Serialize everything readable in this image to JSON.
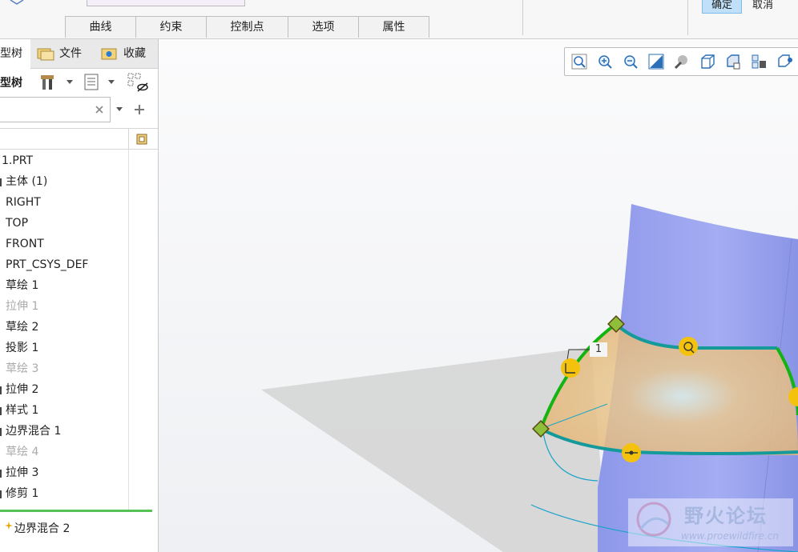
{
  "ribbon": {
    "tabs": [
      "曲线",
      "约束",
      "控制点",
      "选项",
      "属性"
    ],
    "ok_label": "确定",
    "cancel_label": "取消"
  },
  "panel": {
    "tabs": [
      {
        "label": "型树",
        "icon": "model-tree-icon"
      },
      {
        "label": "文件",
        "icon": "folder-icon"
      },
      {
        "label": "收藏",
        "icon": "favorites-icon"
      }
    ],
    "tree_title": "型树",
    "search": {
      "value": "",
      "clear_icon": "close-icon"
    },
    "tree_items": [
      {
        "label": "1.PRT",
        "state": "normal"
      },
      {
        "label": "主体 (1)",
        "state": "normal"
      },
      {
        "label": "RIGHT",
        "state": "normal"
      },
      {
        "label": "TOP",
        "state": "normal"
      },
      {
        "label": "FRONT",
        "state": "normal"
      },
      {
        "label": "PRT_CSYS_DEF",
        "state": "normal"
      },
      {
        "label": "草绘 1",
        "state": "normal"
      },
      {
        "label": "拉伸 1",
        "state": "suppressed"
      },
      {
        "label": "草绘 2",
        "state": "normal"
      },
      {
        "label": "投影 1",
        "state": "normal"
      },
      {
        "label": "草绘 3",
        "state": "suppressed"
      },
      {
        "label": "拉伸 2",
        "state": "normal"
      },
      {
        "label": "样式 1",
        "state": "normal"
      },
      {
        "label": "边界混合 1",
        "state": "normal"
      },
      {
        "label": "草绘 4",
        "state": "suppressed"
      },
      {
        "label": "拉伸 3",
        "state": "normal"
      },
      {
        "label": "修剪 1",
        "state": "normal"
      }
    ],
    "active_feature": "边界混合 2"
  },
  "view_toolbar": {
    "icons": [
      "zoom-fit-icon",
      "zoom-in-icon",
      "zoom-out-icon",
      "repaint-icon",
      "appearance-icon",
      "display-style-icon",
      "saved-views-icon",
      "view-manager-icon",
      "annotation-display-icon"
    ]
  },
  "viewport": {
    "dimension_label": "1",
    "watermark_title": "野火论坛",
    "watermark_url": "www.proewildfire.cn",
    "colors": {
      "cylinder": "#9aa4ee",
      "plane": "#d6d6d6",
      "surface": "#e9c48d",
      "boundary_green": "#11b411",
      "curve_teal": "#149a9a",
      "handle_yellow": "#f4c20d"
    }
  }
}
